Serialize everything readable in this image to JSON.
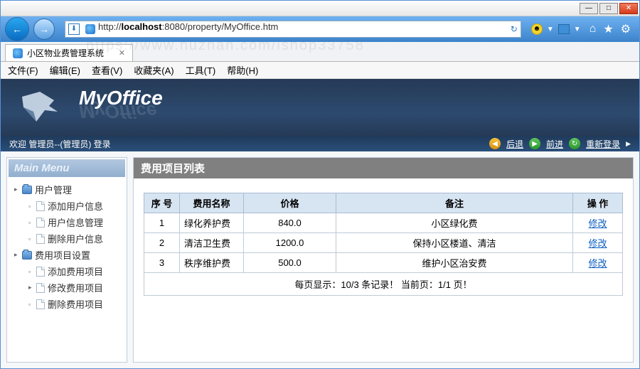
{
  "url_display": "http://localhost:8080/property/MyOffice.htm",
  "url_host": "localhost",
  "tab_title": "小区物业费管理系统",
  "menubar": [
    "文件(F)",
    "编辑(E)",
    "查看(V)",
    "收藏夹(A)",
    "工具(T)",
    "帮助(H)"
  ],
  "app_name": "MyOffice",
  "welcome": "欢迎 管理员--(管理员) 登录",
  "nav_actions": {
    "back": "后退",
    "forward": "前进",
    "relogin": "重新登录"
  },
  "sidebar_title": "Main Menu",
  "tree": {
    "groups": [
      {
        "label": "用户管理",
        "items": [
          "添加用户信息",
          "用户信息管理",
          "删除用户信息"
        ]
      },
      {
        "label": "费用项目设置",
        "items": [
          "添加费用项目",
          "修改费用项目",
          "删除费用项目"
        ]
      }
    ]
  },
  "page_title": "费用项目列表",
  "table": {
    "headers": [
      "序 号",
      "费用名称",
      "价格",
      "备注",
      "操 作"
    ],
    "rows": [
      {
        "no": "1",
        "name": "绿化养护费",
        "price": "840.0",
        "remark": "小区绿化费",
        "op": "修改"
      },
      {
        "no": "2",
        "name": "清洁卫生费",
        "price": "1200.0",
        "remark": "保持小区楼道、清洁",
        "op": "修改"
      },
      {
        "no": "3",
        "name": "秩序维护费",
        "price": "500.0",
        "remark": "维护小区治安费",
        "op": "修改"
      }
    ]
  },
  "pager_text": "每页显示：10/3 条记录！ 当前页：1/1 页！",
  "watermark": "https://www.huzhan.com/ishop33758"
}
